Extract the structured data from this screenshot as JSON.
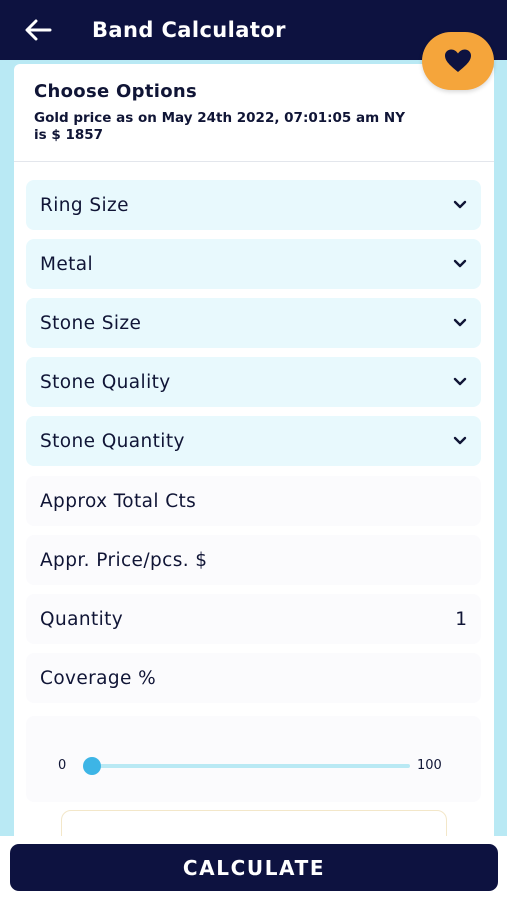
{
  "header": {
    "title": "Band Calculator",
    "back_icon": "arrow-left-icon",
    "favorite_icon": "heart-icon"
  },
  "colors": {
    "navy": "#0d1240",
    "accent_orange": "#f5a53b",
    "light_blue": "#b9e9f4",
    "select_bg": "#e8f9fd",
    "slider_thumb": "#3db5e6"
  },
  "options_card": {
    "title": "Choose Options",
    "gold_price_line1": "Gold price as on May 24th 2022, 07:01:05 am NY",
    "gold_price_line2": "is $ 1857"
  },
  "dropdowns": [
    {
      "label": "Ring Size",
      "icon": "chevron-down-icon"
    },
    {
      "label": "Metal",
      "icon": "chevron-down-icon"
    },
    {
      "label": "Stone Size",
      "icon": "chevron-down-icon"
    },
    {
      "label": "Stone Quality",
      "icon": "chevron-down-icon"
    },
    {
      "label": "Stone Quantity",
      "icon": "chevron-down-icon"
    }
  ],
  "fields": [
    {
      "label": "Approx Total Cts",
      "value": ""
    },
    {
      "label": "Appr. Price/pcs. $",
      "value": ""
    },
    {
      "label": "Quantity",
      "value": "1"
    },
    {
      "label": "Coverage %",
      "value": ""
    }
  ],
  "coverage_slider": {
    "min_label": "0",
    "max_label": "100",
    "value": 0
  },
  "calculate_button": {
    "label": "CALCULATE"
  }
}
